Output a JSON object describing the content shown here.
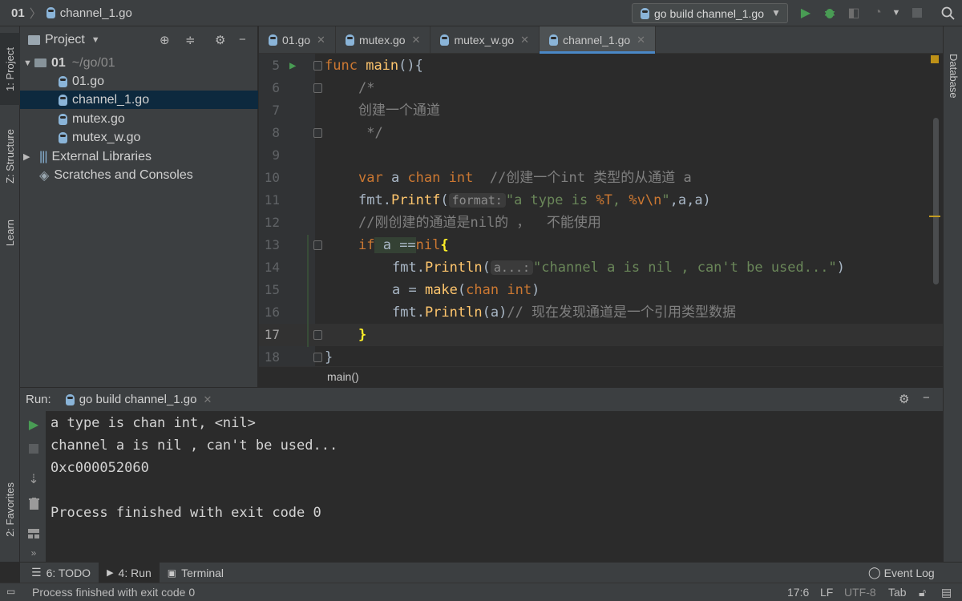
{
  "breadcrumb": {
    "project": "01",
    "file": "channel_1.go"
  },
  "run_config": {
    "label": "go build channel_1.go"
  },
  "left_strip": {
    "project_tab": "1: Project",
    "structure_tab": "Z: Structure",
    "learn_tab": "Learn",
    "favorites_tab": "2: Favorites"
  },
  "right_strip": {
    "database_tab": "Database"
  },
  "project_panel": {
    "title": "Project",
    "root": {
      "name": "01",
      "path": "~/go/01"
    },
    "files": [
      "01.go",
      "channel_1.go",
      "mutex.go",
      "mutex_w.go"
    ],
    "external": "External Libraries",
    "scratches": "Scratches and Consoles"
  },
  "tabs": [
    {
      "label": "01.go"
    },
    {
      "label": "mutex.go"
    },
    {
      "label": "mutex_w.go"
    },
    {
      "label": "channel_1.go"
    }
  ],
  "editor": {
    "line_numbers": [
      "5",
      "6",
      "7",
      "8",
      "9",
      "10",
      "11",
      "12",
      "13",
      "14",
      "15",
      "16",
      "17",
      "18"
    ],
    "l5_kw": "func",
    "l5_fn": "main",
    "l5_rest": "(){",
    "l6": "/*",
    "l7": "创建一个通道",
    "l8": " */",
    "l10_kw1": "var",
    "l10_a": " a ",
    "l10_kw2": "chan",
    "l10_sp": " ",
    "l10_kw3": "int",
    "l10_cm": "  //创建一个int 类型的从通道 a",
    "l11_pre": "fmt.",
    "l11_fn": "Printf",
    "l11_paren": "(",
    "l11_hint": "format:",
    "l11_str1": "\"a type is ",
    "l11_esc1": "%T",
    "l11_str2": ", ",
    "l11_esc2": "%v\\n",
    "l11_str3": "\"",
    "l11_rest": ",a,a)",
    "l12": "//刚创建的通道是nil的 ，  不能使用",
    "l13_kw": "if",
    "l13_hl": " a ==",
    "l13_kw2": "nil",
    "l13_brace": "{",
    "l14_pre": "fmt.",
    "l14_fn": "Println",
    "l14_paren": "(",
    "l14_hint": "a...:",
    "l14_str": "\"channel a is nil , can't be used...\"",
    "l14_close": ")",
    "l15_pre": "a = ",
    "l15_fn": "make",
    "l15_paren": "(",
    "l15_kw1": "chan",
    "l15_sp": " ",
    "l15_kw2": "int",
    "l15_close": ")",
    "l16_pre": "fmt.",
    "l16_fn": "Println",
    "l16_rest": "(a)",
    "l16_cm": "// 现在发现通道是一个引用类型数据",
    "l17": "}",
    "l18": "}",
    "context": "main()"
  },
  "run": {
    "label": "Run:",
    "tab": "go build channel_1.go",
    "output": [
      "a type is chan int, <nil>",
      "channel a is nil , can't be used...",
      "0xc000052060",
      "",
      "Process finished with exit code 0"
    ]
  },
  "bottom_tabs": {
    "todo": "6: TODO",
    "run": "4: Run",
    "terminal": "Terminal",
    "event_log": "Event Log"
  },
  "status_bar": {
    "message": "Process finished with exit code 0",
    "position": "17:6",
    "line_sep": "LF",
    "encoding": "UTF-8",
    "indent": "Tab"
  }
}
